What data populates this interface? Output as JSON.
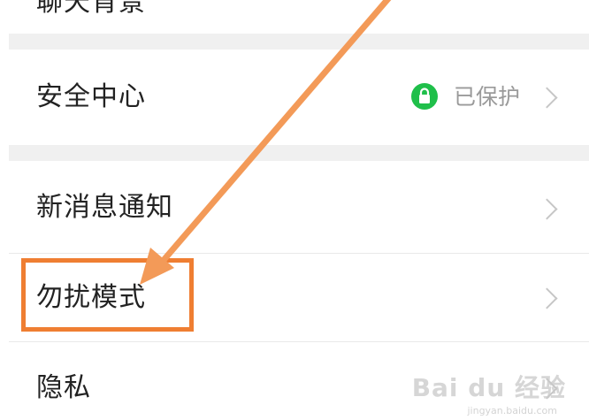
{
  "rows": {
    "cutoff_label": "聊天背景",
    "security_center": {
      "label": "安全中心",
      "status": "已保护",
      "status_icon": "lock-icon"
    },
    "new_message_notification": {
      "label": "新消息通知"
    },
    "do_not_disturb": {
      "label": "勿扰模式"
    },
    "privacy": {
      "label": "隐私"
    }
  },
  "annotation": {
    "highlight_color": "#ef7e32",
    "arrow_color": "#f39a58"
  },
  "watermark": {
    "text": "Bai du 经验",
    "url": "jingyan.baidu.com"
  }
}
